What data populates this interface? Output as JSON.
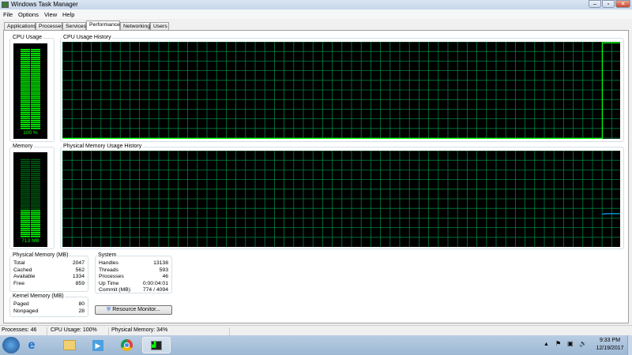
{
  "window": {
    "title": "Windows Task Manager"
  },
  "menu": [
    "File",
    "Options",
    "View",
    "Help"
  ],
  "tabs": [
    "Applications",
    "Processes",
    "Services",
    "Performance",
    "Networking",
    "Users"
  ],
  "active_tab": "Performance",
  "cpu": {
    "label": "CPU Usage",
    "value": "100 %",
    "percent": 100
  },
  "cpu_history": {
    "label": "CPU Usage History"
  },
  "memory": {
    "label": "Memory",
    "value": "713 MB",
    "percent": 34
  },
  "memory_history": {
    "label": "Physical Memory Usage History"
  },
  "physical_memory": {
    "label": "Physical Memory (MB)",
    "rows": [
      {
        "k": "Total",
        "v": "2047"
      },
      {
        "k": "Cached",
        "v": "562"
      },
      {
        "k": "Available",
        "v": "1334"
      },
      {
        "k": "Free",
        "v": "859"
      }
    ]
  },
  "kernel_memory": {
    "label": "Kernel Memory (MB)",
    "rows": [
      {
        "k": "Paged",
        "v": "80"
      },
      {
        "k": "Nonpaged",
        "v": "28"
      }
    ]
  },
  "system": {
    "label": "System",
    "rows": [
      {
        "k": "Handles",
        "v": "13138"
      },
      {
        "k": "Threads",
        "v": "593"
      },
      {
        "k": "Processes",
        "v": "46"
      },
      {
        "k": "Up Time",
        "v": "0:00:04:01"
      },
      {
        "k": "Commit (MB)",
        "v": "774 / 4094"
      }
    ]
  },
  "resource_monitor_label": "Resource Monitor...",
  "status": {
    "processes": "Processes: 46",
    "cpu": "CPU Usage: 100%",
    "memory": "Physical Memory: 34%"
  },
  "clock": {
    "time": "9:33 PM",
    "date": "12/19/2017"
  },
  "colors": {
    "graph_bg": "#000000",
    "grid": "#008040",
    "cpu_line": "#00ff00",
    "mem_line": "#00aaff"
  }
}
